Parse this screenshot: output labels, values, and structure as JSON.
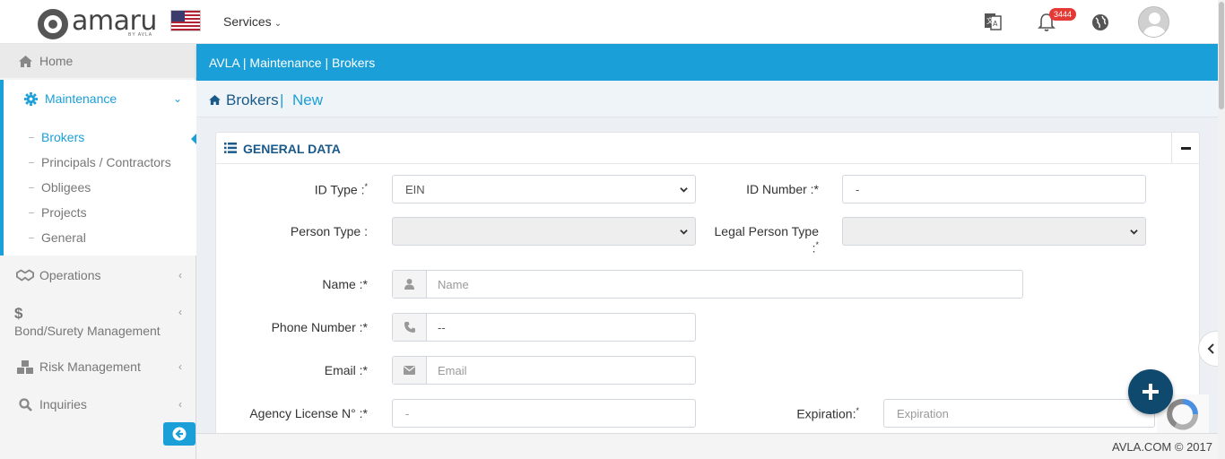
{
  "header": {
    "logo_text": "amaru",
    "logo_sub": "BY AVLA",
    "services_label": "Services",
    "notification_count": "3444"
  },
  "sidebar": {
    "home": "Home",
    "maintenance": "Maintenance",
    "submenu": [
      "Brokers",
      "Principals / Contractors",
      "Obligees",
      "Projects",
      "General"
    ],
    "operations": "Operations",
    "bond": "Bond/Surety Management",
    "risk": "Risk Management",
    "inquiries": "Inquiries"
  },
  "breadcrumb_bar": "AVLA | Maintenance | Brokers",
  "page": {
    "title": "Brokers",
    "separator": "|",
    "mode": "New"
  },
  "panel": {
    "title": "GENERAL DATA"
  },
  "form": {
    "id_type_label": "ID Type :",
    "id_type_value": "EIN",
    "id_number_label": "ID Number :*",
    "id_number_value": "-",
    "person_type_label": "Person Type :",
    "legal_person_type_label": "Legal Person Type",
    "legal_person_type_colon": ":",
    "name_label": "Name :*",
    "name_placeholder": "Name",
    "phone_label": "Phone Number :*",
    "phone_value": "--",
    "email_label": "Email :*",
    "email_placeholder": "Email",
    "license_label": "Agency License N° :*",
    "license_value": "-",
    "expiration_label": "Expiration:",
    "expiration_placeholder": "Expiration",
    "required_mark": "*"
  },
  "footer": "AVLA.COM © 2017",
  "colors": {
    "accent": "#1a9fd9",
    "fab": "#0f4a6e",
    "badge": "#e53935"
  }
}
